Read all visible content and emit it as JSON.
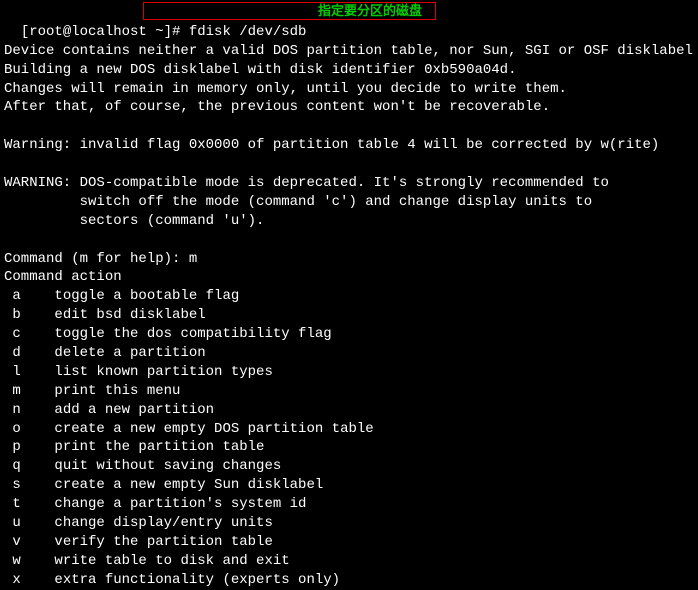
{
  "prompt": {
    "text": "[root@localhost ~]# ",
    "command": "fdisk /dev/sdb"
  },
  "annotation": {
    "label": "指定要分区的磁盘"
  },
  "output": {
    "l1": "Device contains neither a valid DOS partition table, nor Sun, SGI or OSF disklabel",
    "l2": "Building a new DOS disklabel with disk identifier 0xb590a04d.",
    "l3": "Changes will remain in memory only, until you decide to write them.",
    "l4": "After that, of course, the previous content won't be recoverable.",
    "l5": "Warning: invalid flag 0x0000 of partition table 4 will be corrected by w(rite)",
    "l6": "WARNING: DOS-compatible mode is deprecated. It's strongly recommended to",
    "l7": "         switch off the mode (command 'c') and change display units to",
    "l8": "         sectors (command 'u').",
    "cmd_prompt": "Command (m for help): ",
    "cmd_input": "m",
    "action_header": "Command action"
  },
  "commands": [
    {
      "key": "a",
      "desc": "toggle a bootable flag"
    },
    {
      "key": "b",
      "desc": "edit bsd disklabel"
    },
    {
      "key": "c",
      "desc": "toggle the dos compatibility flag"
    },
    {
      "key": "d",
      "desc": "delete a partition"
    },
    {
      "key": "l",
      "desc": "list known partition types"
    },
    {
      "key": "m",
      "desc": "print this menu"
    },
    {
      "key": "n",
      "desc": "add a new partition"
    },
    {
      "key": "o",
      "desc": "create a new empty DOS partition table"
    },
    {
      "key": "p",
      "desc": "print the partition table"
    },
    {
      "key": "q",
      "desc": "quit without saving changes"
    },
    {
      "key": "s",
      "desc": "create a new empty Sun disklabel"
    },
    {
      "key": "t",
      "desc": "change a partition's system id"
    },
    {
      "key": "u",
      "desc": "change display/entry units"
    },
    {
      "key": "v",
      "desc": "verify the partition table"
    },
    {
      "key": "w",
      "desc": "write table to disk and exit"
    },
    {
      "key": "x",
      "desc": "extra functionality (experts only)"
    }
  ]
}
